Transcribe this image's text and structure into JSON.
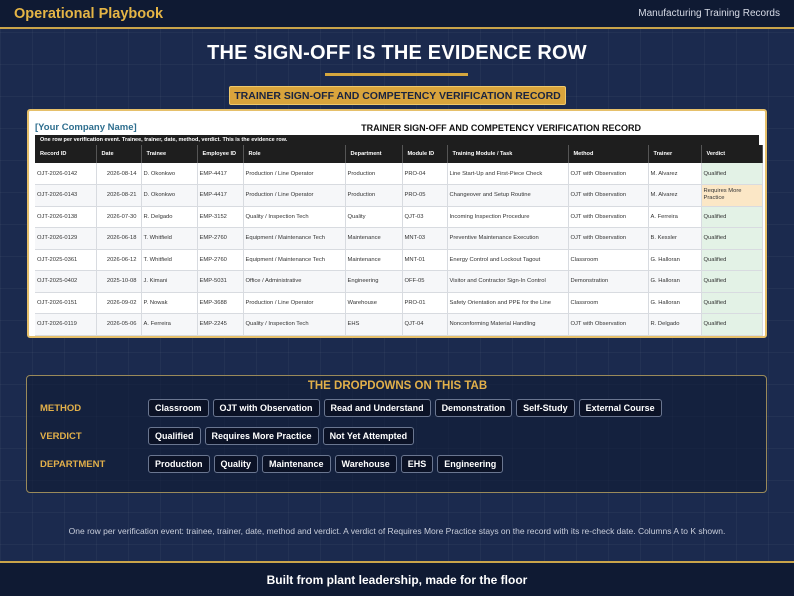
{
  "header": {
    "brand": "Operational Playbook",
    "section": "Manufacturing Training Records"
  },
  "headline": "THE SIGN-OFF IS THE EVIDENCE ROW",
  "subtitle_badge": "TRAINER SIGN-OFF AND COMPETENCY VERIFICATION RECORD",
  "sheet": {
    "company": "[Your Company Name]",
    "title": "TRAINER SIGN-OFF AND COMPETENCY VERIFICATION RECORD",
    "note": "One row per verification event. Trainee, trainer, date, method, verdict. This is the evidence row.",
    "columns": [
      "Record ID",
      "Date",
      "Trainee",
      "Employee ID",
      "Role",
      "Department",
      "Module ID",
      "Training Module / Task",
      "Method",
      "Trainer",
      "Verdict"
    ],
    "rows": [
      [
        "OJT-2026-0142",
        "2026-08-14",
        "D. Okonkwo",
        "EMP-4417",
        "Production / Line Operator",
        "Production",
        "PRO-04",
        "Line Start-Up and First-Piece Check",
        "OJT with Observation",
        "M. Alvarez",
        "Qualified"
      ],
      [
        "OJT-2026-0143",
        "2026-08-21",
        "D. Okonkwo",
        "EMP-4417",
        "Production / Line Operator",
        "Production",
        "PRO-05",
        "Changeover and Setup Routine",
        "OJT with Observation",
        "M. Alvarez",
        "Requires More Practice"
      ],
      [
        "OJT-2026-0138",
        "2026-07-30",
        "R. Delgado",
        "EMP-3152",
        "Quality / Inspection Tech",
        "Quality",
        "QJT-03",
        "Incoming Inspection Procedure",
        "OJT with Observation",
        "A. Ferreira",
        "Qualified"
      ],
      [
        "OJT-2026-0129",
        "2026-06-18",
        "T. Whitfield",
        "EMP-2760",
        "Equipment / Maintenance Tech",
        "Maintenance",
        "MNT-03",
        "Preventive Maintenance Execution",
        "OJT with Observation",
        "B. Kessler",
        "Qualified"
      ],
      [
        "OJT-2025-0361",
        "2026-06-12",
        "T. Whitfield",
        "EMP-2760",
        "Equipment / Maintenance Tech",
        "Maintenance",
        "MNT-01",
        "Energy Control and Lockout Tagout",
        "Classroom",
        "G. Halloran",
        "Qualified"
      ],
      [
        "OJT-2025-0402",
        "2025-10-08",
        "J. Kimani",
        "EMP-5031",
        "Office / Administrative",
        "Engineering",
        "OFF-05",
        "Visitor and Contractor Sign-In Control",
        "Demonstration",
        "G. Halloran",
        "Qualified"
      ],
      [
        "OJT-2026-0151",
        "2026-09-02",
        "P. Nowak",
        "EMP-3688",
        "Production / Line Operator",
        "Warehouse",
        "PRO-01",
        "Safety Orientation and PPE for the Line",
        "Classroom",
        "G. Halloran",
        "Qualified"
      ],
      [
        "OJT-2026-0119",
        "2026-05-06",
        "A. Ferreira",
        "EMP-2245",
        "Quality / Inspection Tech",
        "EHS",
        "QJT-04",
        "Nonconforming Material Handling",
        "OJT with Observation",
        "R. Delgado",
        "Qualified"
      ]
    ]
  },
  "dropdowns": {
    "title": "THE DROPDOWNS ON THIS TAB",
    "method": {
      "label": "METHOD",
      "options": [
        "Classroom",
        "OJT with Observation",
        "Read and Understand",
        "Demonstration",
        "Self-Study",
        "External Course"
      ]
    },
    "verdict": {
      "label": "VERDICT",
      "options": [
        "Qualified",
        "Requires More Practice",
        "Not Yet Attempted"
      ]
    },
    "department": {
      "label": "DEPARTMENT",
      "options": [
        "Production",
        "Quality",
        "Maintenance",
        "Warehouse",
        "EHS",
        "Engineering"
      ]
    }
  },
  "footnote": "One row per verification event: trainee, trainer, date, method and verdict. A verdict of Requires More Practice stays on the record with its re-check date. Columns A to K shown.",
  "footer": "Built from plant leadership, made for the floor",
  "colors": {
    "navy": "#1b2a4e",
    "gold": "#d9a43c",
    "qualified": "#e3f2e6",
    "needs_practice": "#fbe7c6"
  }
}
